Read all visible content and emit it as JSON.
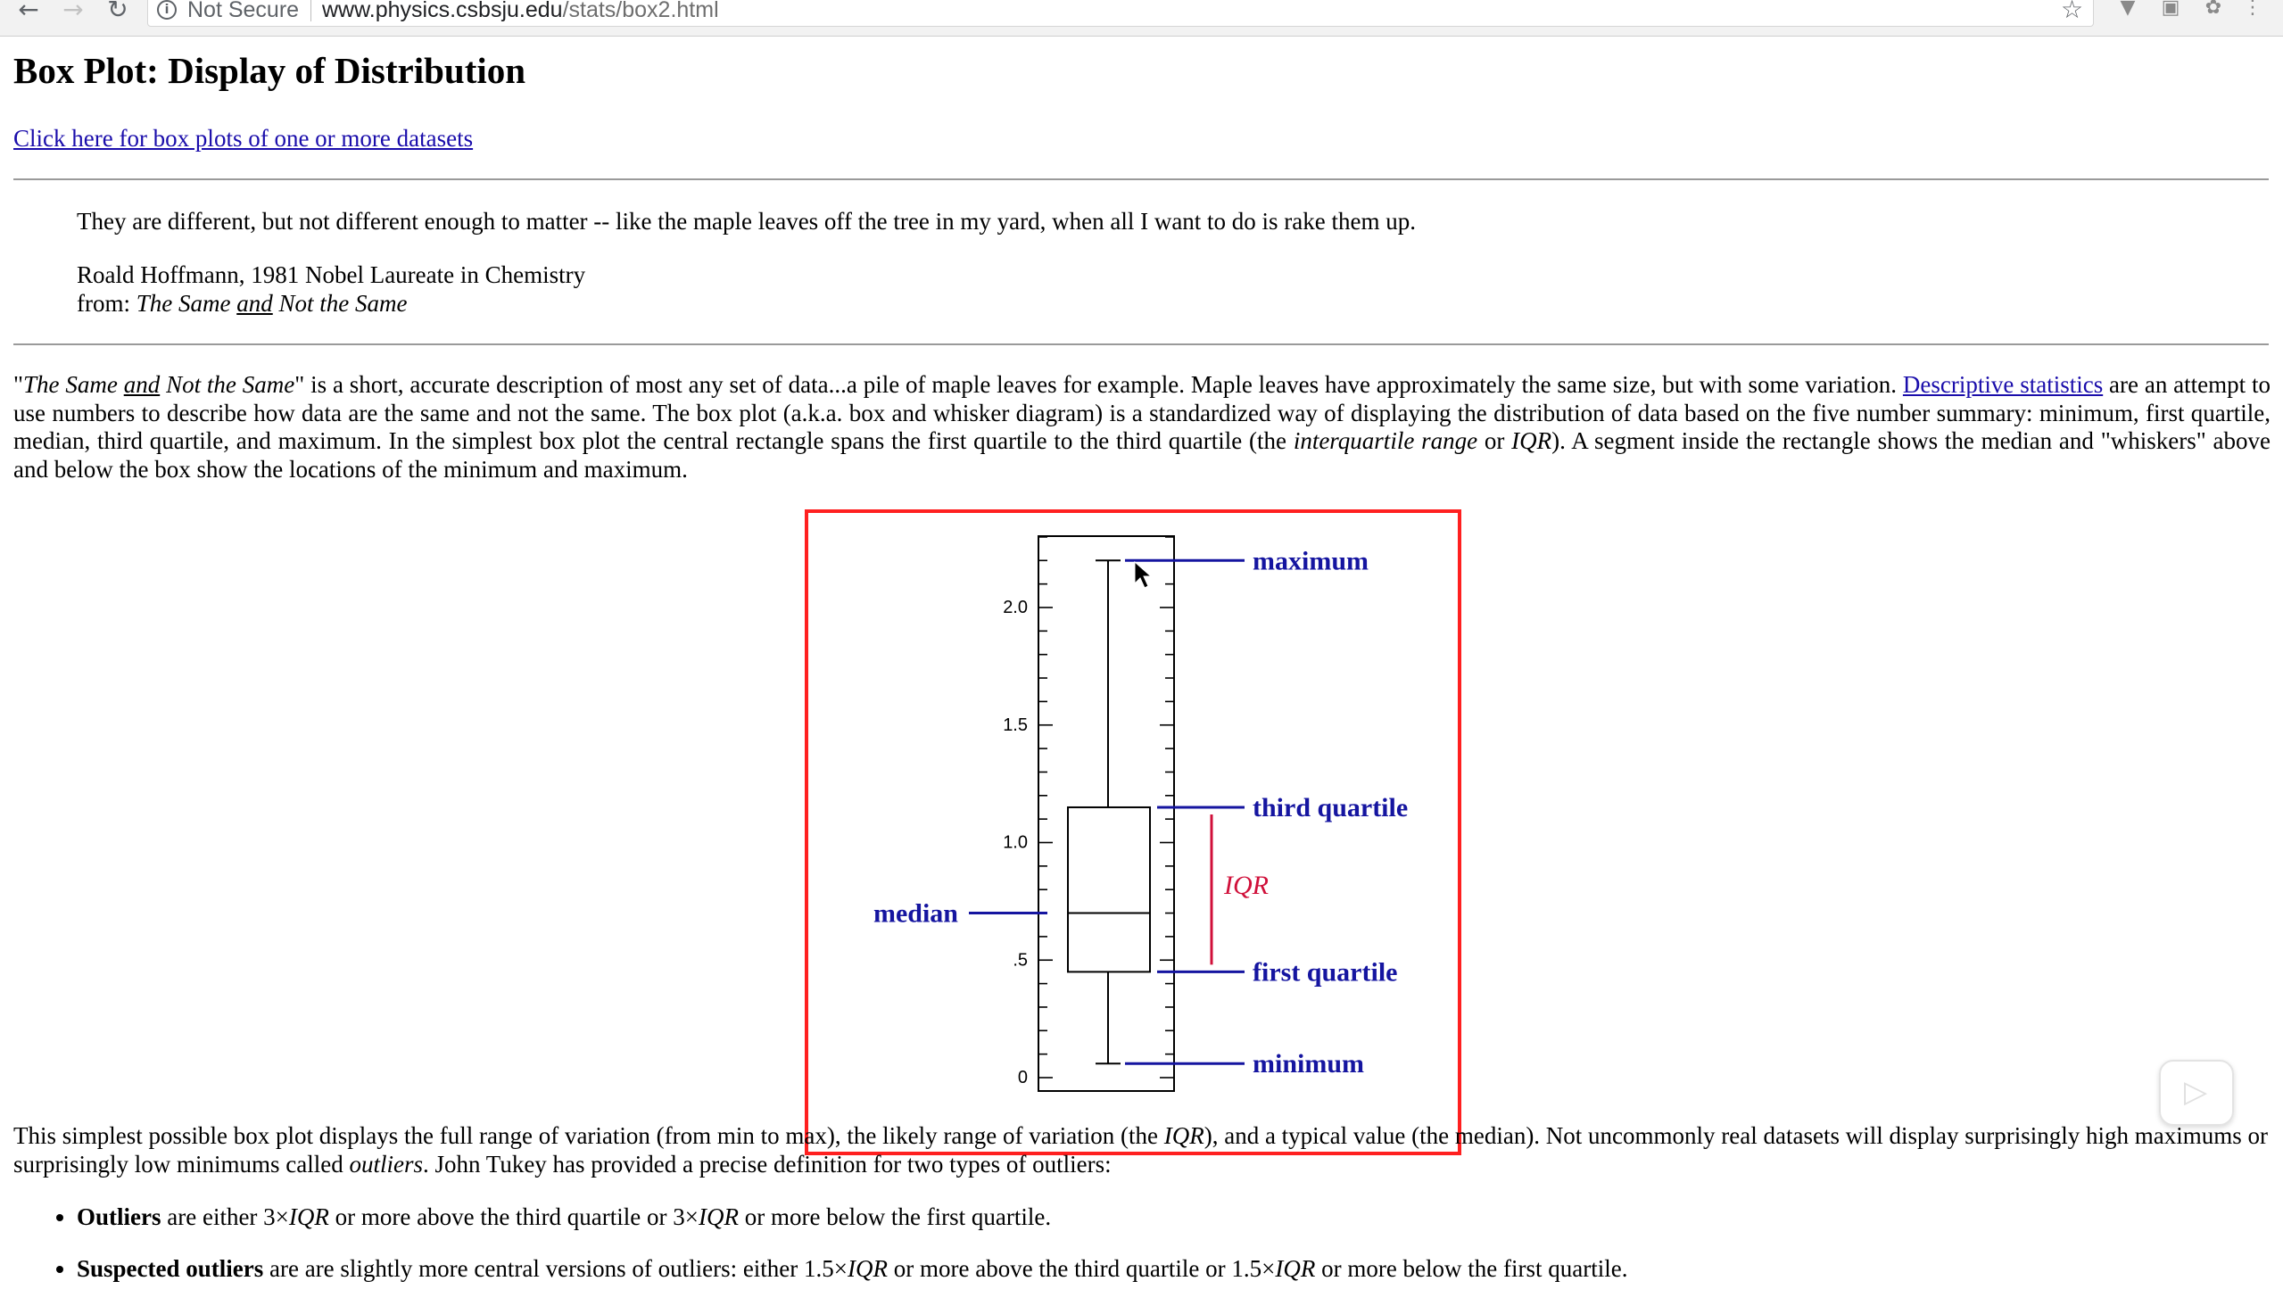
{
  "browser": {
    "security_label": "Not Secure",
    "url_host": "www.physics.csbsju.edu",
    "url_path": "/stats/box2.html"
  },
  "page": {
    "title": "Box Plot: Display of Distribution",
    "link_text": "Click here for box plots of one or more datasets",
    "quote": "They are different, but not different enough to matter -- like the maple leaves off the tree in my yard, when all I want to do is rake them up.",
    "attribution_line1": "Roald Hoffmann, 1981 Nobel Laureate in Chemistry",
    "attribution_from": "from: ",
    "book_title_1": "The Same ",
    "book_title_and": "and",
    "book_title_2": " Not the Same",
    "para1_title_1": "The Same ",
    "para1_title_and": "and",
    "para1_title_2": " Not the Same",
    "para1_part1": "\" is a short, accurate description of most any set of data...a pile of maple leaves for example. Maple leaves have approximately the same size, but with some variation. ",
    "para1_link": "Descriptive statistics",
    "para1_part2": " are an attempt to use numbers to describe how data are the same and not the same. The box plot (a.k.a. box and whisker diagram) is a standardized way of displaying the distribution of data based on the five number summary: minimum, first quartile, median, third quartile, and maximum. In the simplest box plot the central rectangle spans the first quartile to the third quartile (the ",
    "para1_iqr_term": "interquartile range",
    "para1_or": " or ",
    "para1_iqr": "IQR",
    "para1_part3": "). A segment inside the rectangle shows the median and \"whiskers\" above and below the box show the locations of the minimum and maximum.",
    "para2_part1": "This simplest possible box plot displays the full range of variation (from min to max), the likely range of variation (the ",
    "para2_iqr": "IQR",
    "para2_part2": "), and a typical value (the median). Not uncommonly real datasets will display surprisingly high maximums or surprisingly low minimums called ",
    "para2_outliers": "outliers",
    "para2_part3": ". John Tukey has provided a precise definition for two types of outliers:",
    "bullet1_bold": "Outliers",
    "bullet1_a": " are either 3×",
    "bullet1_iqr1": "IQR",
    "bullet1_b": " or more above the third quartile or 3×",
    "bullet1_iqr2": "IQR",
    "bullet1_c": " or more below the first quartile.",
    "bullet2_bold": "Suspected outliers",
    "bullet2_a": " are are slightly more central versions of outliers: either 1.5×",
    "bullet2_iqr1": "IQR",
    "bullet2_b": " or more above the third quartile or 1.5×",
    "bullet2_iqr2": "IQR",
    "bullet2_c": " or more below the first quartile."
  },
  "chart_data": {
    "type": "box",
    "ylim": [
      0,
      2.35
    ],
    "tick_labels": [
      "0",
      ".5",
      "1.0",
      "1.5",
      "2.0"
    ],
    "tick_values": [
      0,
      0.5,
      1.0,
      1.5,
      2.0
    ],
    "minimum": 0.06,
    "first_quartile": 0.45,
    "median": 0.7,
    "third_quartile": 1.15,
    "maximum": 2.2,
    "labels": {
      "maximum": "maximum",
      "third_quartile": "third quartile",
      "iqr": "IQR",
      "median": "median",
      "first_quartile": "first quartile",
      "minimum": "minimum"
    },
    "colors": {
      "label": "#1515a0",
      "iqr": "#d0103a",
      "frame": "#ff2020"
    }
  }
}
